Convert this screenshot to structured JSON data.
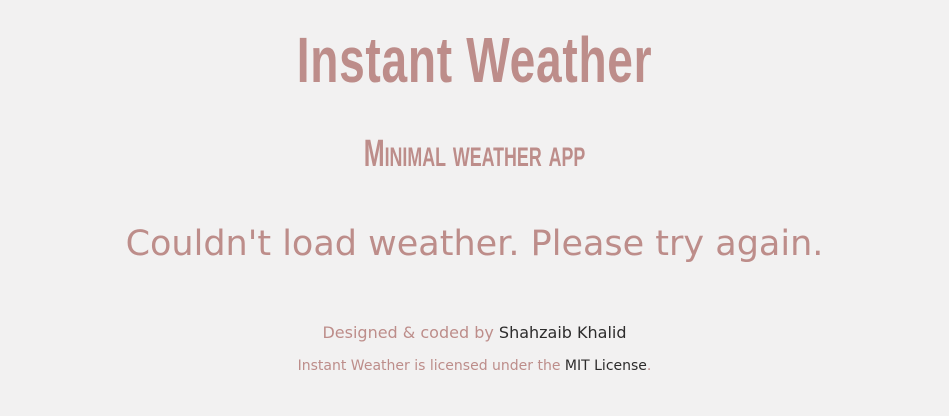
{
  "app": {
    "title": "Instant Weather",
    "subtitle": "Minimal weather app",
    "status_message": "Couldn't load weather. Please try again."
  },
  "footer": {
    "credit_prefix": "Designed & coded by",
    "credit_link_text": "Shahzaib Khalid",
    "license_prefix": "Instant Weather is licensed under the",
    "license_link_text": "MIT License",
    "license_suffix": "."
  },
  "colors": {
    "background": "#f2f1f1",
    "accent": "#bd8d8a",
    "link": "#2d2c2c"
  }
}
